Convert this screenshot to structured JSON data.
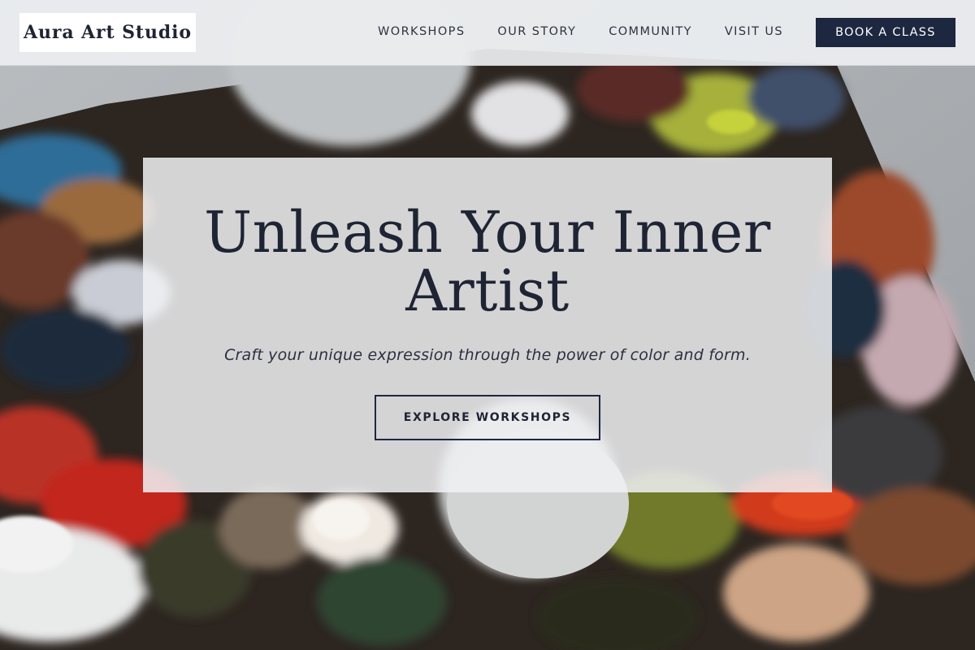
{
  "brand": {
    "name": "Aura Art Studio"
  },
  "nav": {
    "items": [
      {
        "label": "WORKSHOPS"
      },
      {
        "label": "OUR STORY"
      },
      {
        "label": "COMMUNITY"
      },
      {
        "label": "VISIT US"
      }
    ],
    "cta_label": "BOOK A CLASS"
  },
  "hero": {
    "title": "Unleash Your Inner Artist",
    "subtitle": "Craft your unique expression through the power of color and form.",
    "button_label": "EXPLORE WORKSHOPS"
  },
  "colors": {
    "primary": "#1e2740",
    "text": "#1e2433",
    "header_bg": "#eceef0",
    "card_bg": "#f0f1f3"
  }
}
